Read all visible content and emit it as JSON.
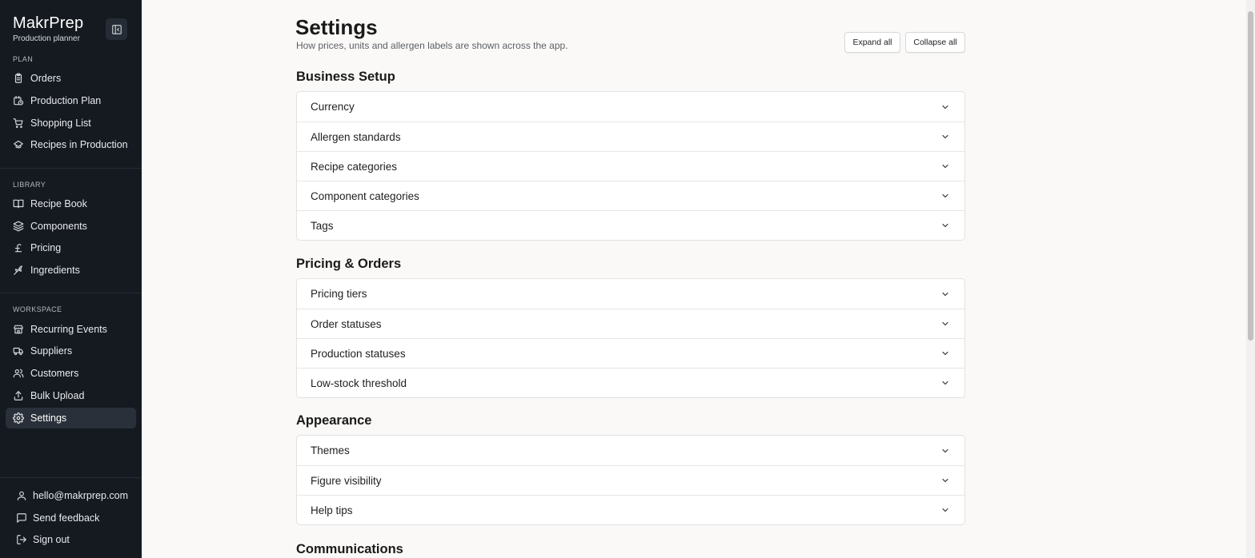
{
  "brand": {
    "name": "MakrPrep",
    "subtitle": "Production planner"
  },
  "sidebar": {
    "sections": [
      {
        "label": "PLAN",
        "items": [
          {
            "label": "Orders",
            "icon": "clipboard-icon"
          },
          {
            "label": "Production Plan",
            "icon": "calendar-clock-icon"
          },
          {
            "label": "Shopping List",
            "icon": "cart-icon"
          },
          {
            "label": "Recipes in Production",
            "icon": "chef-hat-icon"
          }
        ]
      },
      {
        "label": "LIBRARY",
        "items": [
          {
            "label": "Recipe Book",
            "icon": "book-open-icon"
          },
          {
            "label": "Components",
            "icon": "layers-icon"
          },
          {
            "label": "Pricing",
            "icon": "pound-icon"
          },
          {
            "label": "Ingredients",
            "icon": "wheat-icon"
          }
        ]
      },
      {
        "label": "WORKSPACE",
        "items": [
          {
            "label": "Recurring Events",
            "icon": "store-icon"
          },
          {
            "label": "Suppliers",
            "icon": "truck-icon"
          },
          {
            "label": "Customers",
            "icon": "users-icon"
          },
          {
            "label": "Bulk Upload",
            "icon": "upload-icon"
          },
          {
            "label": "Settings",
            "icon": "gear-icon",
            "active": true
          }
        ]
      }
    ],
    "footer": [
      {
        "label": "hello@makrprep.com",
        "icon": "user-icon"
      },
      {
        "label": "Send feedback",
        "icon": "message-icon"
      },
      {
        "label": "Sign out",
        "icon": "sign-out-icon"
      }
    ]
  },
  "page": {
    "title": "Settings",
    "subtitle": "How prices, units and allergen labels are shown across the app.",
    "expand_all": "Expand all",
    "collapse_all": "Collapse all"
  },
  "groups": [
    {
      "title": "Business Setup",
      "rows": [
        "Currency",
        "Allergen standards",
        "Recipe categories",
        "Component categories",
        "Tags"
      ]
    },
    {
      "title": "Pricing & Orders",
      "rows": [
        "Pricing tiers",
        "Order statuses",
        "Production statuses",
        "Low-stock threshold"
      ]
    },
    {
      "title": "Appearance",
      "rows": [
        "Themes",
        "Figure visibility",
        "Help tips"
      ]
    },
    {
      "title": "Communications",
      "rows": []
    }
  ],
  "colors": {
    "sidebar_bg": "#151a21",
    "active_item_bg": "#2a3039",
    "page_bg": "#faf9f7"
  }
}
